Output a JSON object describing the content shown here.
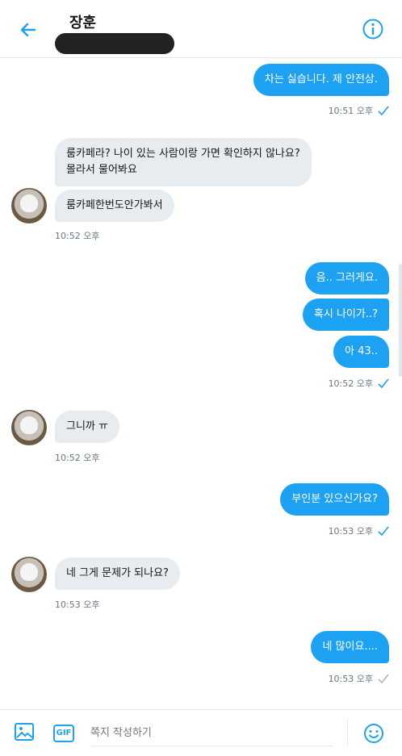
{
  "header": {
    "contact_name": "장훈"
  },
  "composer": {
    "placeholder": "쪽지 작성하기",
    "gif_label": "GIF"
  },
  "messages": [
    {
      "dir": "out",
      "text": "차는 싫습니다. 제 안전상."
    },
    {
      "dir": "out",
      "time": "10:51 오후"
    },
    {
      "dir": "in",
      "text": "룸카페라? 나이 있는 사람이랑 가면 확인하지 않나요? 몰라서 물어봐요"
    },
    {
      "dir": "in",
      "text": "룸카페한번도안가봐서"
    },
    {
      "dir": "in",
      "time": "10:52 오후"
    },
    {
      "dir": "out",
      "text": "음.. 그러게요."
    },
    {
      "dir": "out",
      "text": "혹시 나이가..?"
    },
    {
      "dir": "out",
      "text": "아 43.."
    },
    {
      "dir": "out",
      "time": "10:52 오후"
    },
    {
      "dir": "in",
      "text": "그니까 ㅠ"
    },
    {
      "dir": "in",
      "time": "10:52 오후"
    },
    {
      "dir": "out",
      "text": "부인분 있으신가요?"
    },
    {
      "dir": "out",
      "time": "10:53 오후"
    },
    {
      "dir": "in",
      "text": "네 그게 문제가 되나요?"
    },
    {
      "dir": "in",
      "time": "10:53 오후"
    },
    {
      "dir": "out",
      "text": "네 많이요...."
    },
    {
      "dir": "out",
      "time": "10:53 오후"
    }
  ],
  "colors": {
    "accent": "#1da1f2",
    "incoming_bubble": "#e6ecf0",
    "meta_text": "#657786"
  }
}
